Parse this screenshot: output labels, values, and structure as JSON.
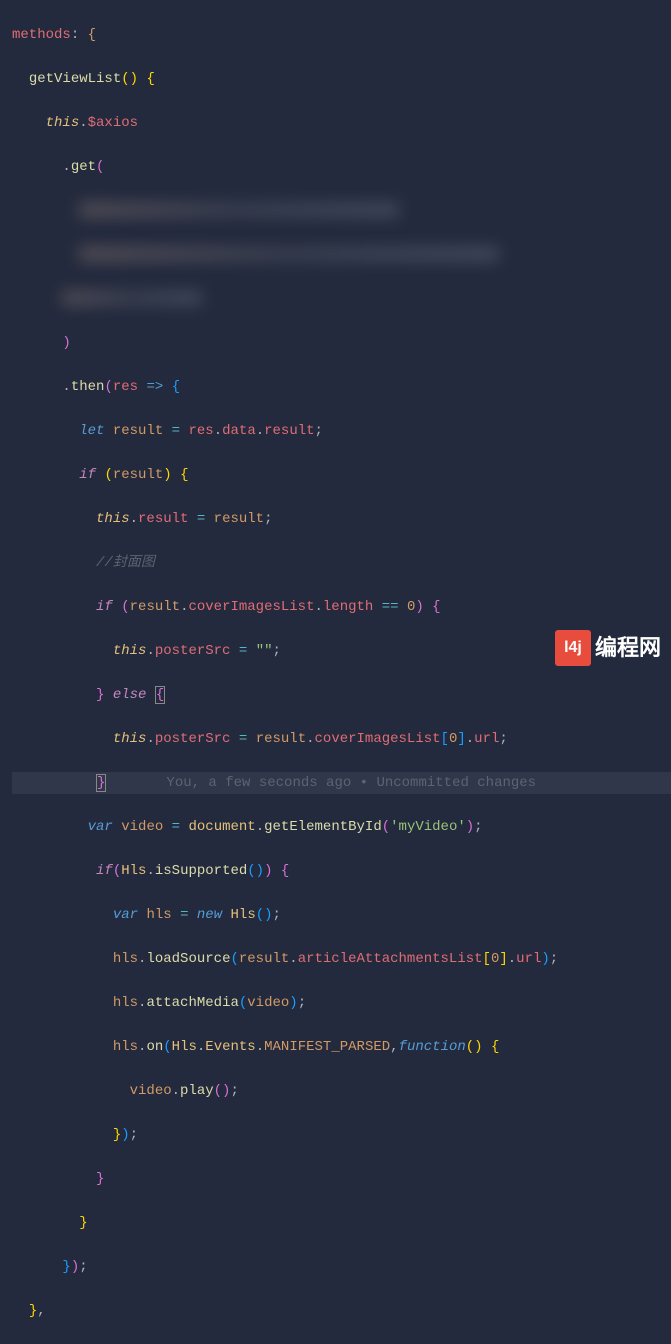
{
  "code": {
    "l1": {
      "methods": "methods",
      "colon": ":",
      "brace": "{"
    },
    "l2": {
      "fn": "getViewList",
      "parens": "()",
      "brace": "{"
    },
    "l3": {
      "this": "this",
      "dot": ".",
      "axios": "$axios"
    },
    "l4": {
      "get": ".get("
    },
    "l8": {
      "close_paren": ")"
    },
    "l9": {
      "then": "then",
      "res": "res",
      "arrow": "=>",
      "brace": "{"
    },
    "l10": {
      "let": "let",
      "result": "result",
      "eq": "=",
      "res": "res",
      "data": "data",
      "result2": "result",
      "semi": ";"
    },
    "l11": {
      "if": "if",
      "result": "result",
      "brace": "{"
    },
    "l12": {
      "this": "this",
      "result": "result",
      "eq": "=",
      "result2": "result",
      "semi": ";"
    },
    "l13": {
      "comment": "//封面图"
    },
    "l14": {
      "if": "if",
      "result": "result",
      "cover": "coverImagesList",
      "length": "length",
      "eqeq": "==",
      "zero": "0",
      "brace": "{"
    },
    "l15": {
      "this": "this",
      "posterSrc": "posterSrc",
      "eq": "=",
      "empty": "\"\"",
      "semi": ";"
    },
    "l16": {
      "brace": "}",
      "else": "else",
      "brace2": "{"
    },
    "l17": {
      "this": "this",
      "posterSrc": "posterSrc",
      "eq": "=",
      "result": "result",
      "cover": "coverImagesList",
      "zero": "0",
      "url": "url",
      "semi": ";"
    },
    "l18": {
      "brace": "}",
      "codelens": "You, a few seconds ago • Uncommitted changes"
    },
    "l19": {
      "var": "var",
      "video": "video",
      "eq": "=",
      "document": "document",
      "getEl": "getElementById",
      "myVideo": "'myVideo'",
      "semi": ";"
    },
    "l20": {
      "if": "if",
      "Hls": "Hls",
      "isSup": "isSupported",
      "brace": "{"
    },
    "l21": {
      "var": "var",
      "hls": "hls",
      "eq": "=",
      "new": "new",
      "Hls": "Hls",
      "semi": ";"
    },
    "l22": {
      "hls": "hls",
      "loadSource": "loadSource",
      "result": "result",
      "attach": "articleAttachmentsList",
      "zero": "0",
      "url": "url",
      "semi": ";"
    },
    "l23": {
      "hls": "hls",
      "attachMedia": "attachMedia",
      "video": "video",
      "semi": ";"
    },
    "l24": {
      "hls": "hls",
      "on": "on",
      "Hls": "Hls",
      "Events": "Events",
      "MANIFEST": "MANIFEST_PARSED",
      "function": "function",
      "brace": "{"
    },
    "l25": {
      "video": "video",
      "play": "play",
      "semi": ";"
    },
    "l26": {
      "brace": "});"
    },
    "l27": {
      "brace": "}"
    },
    "l28": {
      "brace": "}"
    },
    "l29": {
      "brace": "});"
    },
    "l30": {
      "brace": "},"
    }
  },
  "watermark": {
    "text": "编程网",
    "logo": "l4j"
  }
}
